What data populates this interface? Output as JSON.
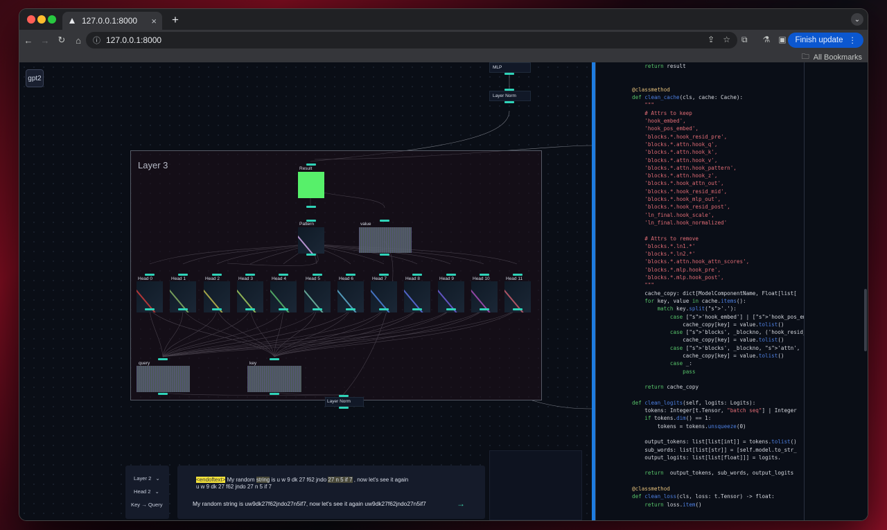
{
  "browser": {
    "tab_title": "127.0.0.1:8000",
    "tab_close": "×",
    "new_tab": "+",
    "url": "127.0.0.1:8000",
    "finish_update": "Finish update",
    "all_bookmarks": "All Bookmarks"
  },
  "graph": {
    "model_button": "gpt2",
    "top_nodes": {
      "mlp": "MLP",
      "layer_norm_top": "Layer Norm"
    },
    "layer_title": "Layer 3",
    "result": "Result",
    "pattern": "Pattern",
    "value": "value",
    "heads": [
      "Head 0",
      "Head 1",
      "Head 2",
      "Head 3",
      "Head 4",
      "Head 5",
      "Head 6",
      "Head 7",
      "Head 8",
      "Head 9",
      "Head 10",
      "Head 11"
    ],
    "query": "query",
    "key": "key",
    "layer_norm_bottom": "Layer Norm",
    "head_colors": [
      "#c43a3a",
      "#7faa60",
      "#b7b24a",
      "#9cc25a",
      "#57b26a",
      "#6fb4a0",
      "#5aa6c8",
      "#4a7cd0",
      "#5a6ad8",
      "#6a5ad0",
      "#a04ab0",
      "#c05a6a"
    ]
  },
  "controls": {
    "layer": "Layer 2",
    "head": "Head 2",
    "mode": "Key → Query",
    "chevron": "⌄"
  },
  "prompt": {
    "tokens_line1_hl": "<endoftext>",
    "tokens_line1_rest_a": "My random",
    "tokens_line1_b": "string",
    "tokens_line1_c": "is u w 9 dk 27 f62 jndo",
    "tokens_line1_d": "27 n 5 if 7",
    "tokens_line1_e": ", now let's see it again",
    "tokens_line2": "u w 9 dk 27 f62 jndo 27 n 5 if 7",
    "text": "My random string is uw9dk27f62jndo27n5if7, now let's see it again uw9dk27f62jndo27n5if7",
    "submit": "→"
  },
  "code_lines": [
    "    return result",
    "",
    "",
    "@classmethod",
    "def clean_cache(cls, cache: Cache):",
    "    \"\"\"",
    "    # Attrs to keep",
    "    'hook_embed',",
    "    'hook_pos_embed',",
    "    'blocks.*.hook_resid_pre',",
    "    'blocks.*.attn.hook_q',",
    "    'blocks.*.attn.hook_k',",
    "    'blocks.*.attn.hook_v',",
    "    'blocks.*.attn.hook_pattern',",
    "    'blocks.*.attn.hook_z',",
    "    'blocks.*.hook_attn_out',",
    "    'blocks.*.hook_resid_mid',",
    "    'blocks.*.hook_mlp_out',",
    "    'blocks.*.hook_resid_post',",
    "    'ln_final.hook_scale',",
    "    'ln_final.hook_normalized'",
    "",
    "    # Attrs to remove",
    "    'blocks.*.ln1.*'",
    "    'blocks.*.ln2.*'",
    "    'blocks.*.attn.hook_attn_scores',",
    "    'blocks.*.mlp.hook_pre',",
    "    'blocks.*.mlp.hook_post',",
    "    \"\"\"",
    "    cache_copy: dict[ModelComponentName, Float[list[",
    "    for key, value in cache.items():",
    "        match key.split('.'):",
    "            case ['hook_embed'] | ['hook_pos_embed']",
    "                cache_copy[key] = value.tolist()",
    "            case ['blocks', _blockno, ('hook_resid_p",
    "                cache_copy[key] = value.tolist()",
    "            case ['blocks', _blockno, 'attn', ('hook",
    "                cache_copy[key] = value.tolist()",
    "            case _:",
    "                pass",
    "",
    "    return cache_copy",
    "",
    "def clean_logits(self, logits: Logits):",
    "    tokens: Integer[t.Tensor, \"batch seq\"] | Integer",
    "    if tokens.dim() == 1:",
    "        tokens = tokens.unsqueeze(0)",
    "",
    "    output_tokens: list[list[int]] = tokens.tolist()",
    "    sub_words: list[list[str]] = [self.model.to_str_",
    "    output_logits: list[list[float]]] = logits.",
    "",
    "    return  output_tokens, sub_words, output_logits",
    "",
    "@classmethod",
    "def clean_loss(cls, loss: t.Tensor) -> float:",
    "    return loss.item()"
  ]
}
